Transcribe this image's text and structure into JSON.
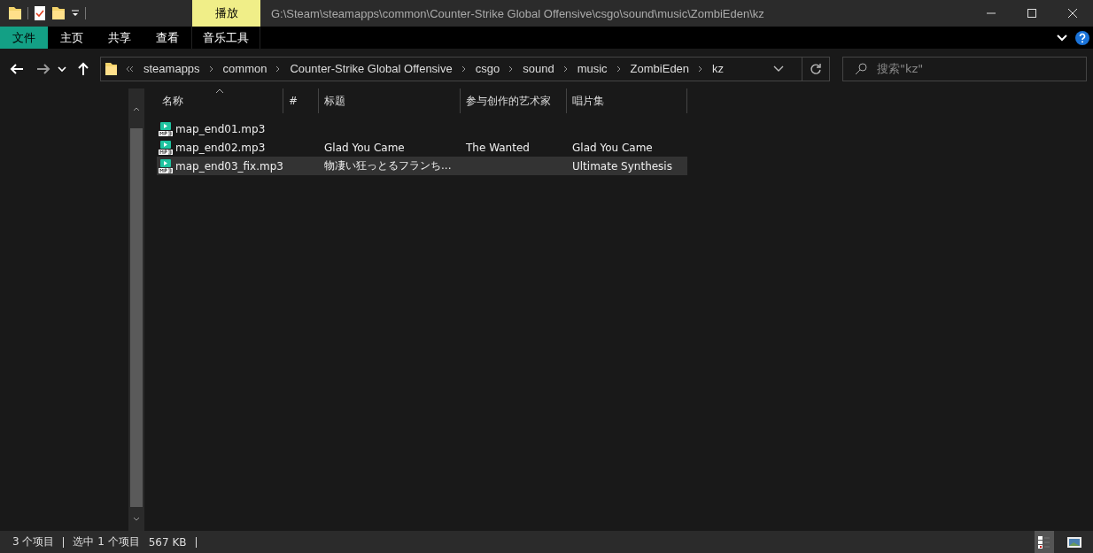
{
  "window": {
    "title": "G:\\Steam\\steamapps\\common\\Counter-Strike Global Offensive\\csgo\\sound\\music\\ZombiEden\\kz",
    "context_tab": "播放"
  },
  "ribbon_tabs": [
    {
      "label": "文件",
      "selected": true
    },
    {
      "label": "主页",
      "selected": false
    },
    {
      "label": "共享",
      "selected": false
    },
    {
      "label": "查看",
      "selected": false
    },
    {
      "label": "音乐工具",
      "selected": false
    }
  ],
  "breadcrumb": [
    "steamapps",
    "common",
    "Counter-Strike Global Offensive",
    "csgo",
    "sound",
    "music",
    "ZombiEden",
    "kz"
  ],
  "search": {
    "placeholder": "搜索\"kz\""
  },
  "table": {
    "columns": [
      "名称",
      "#",
      "标题",
      "参与创作的艺术家",
      "唱片集"
    ],
    "rows": [
      {
        "name": "map_end01.mp3",
        "selected": false
      },
      {
        "name": "map_end02.mp3",
        "title": "Glad You Came",
        "artist": "The Wanted",
        "album": "Glad You Came",
        "selected": false
      },
      {
        "name": "map_end03_fix.mp3",
        "title": "物凄い狂っとるフランち...",
        "album": "Ultimate Synthesis",
        "selected": true
      }
    ]
  },
  "status_bar": {
    "count": "3 个项目",
    "selection": "选中 1 个项目",
    "size": "567 KB"
  }
}
